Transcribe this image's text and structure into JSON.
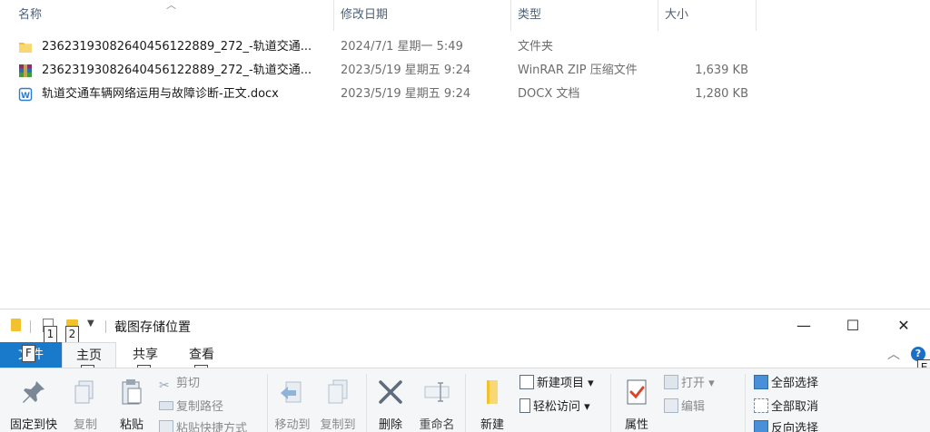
{
  "columns": {
    "name": "名称",
    "modified": "修改日期",
    "type": "类型",
    "size": "大小"
  },
  "files": [
    {
      "icon": "folder-icon",
      "name": "23623193082640456122889_272_-轨道交通...",
      "modified": "2024/7/1 星期一 5:49",
      "type": "文件夹",
      "size": ""
    },
    {
      "icon": "winrar-archive-icon",
      "name": "23623193082640456122889_272_-轨道交通...",
      "modified": "2023/5/19 星期五 9:24",
      "type": "WinRAR ZIP 压缩文件",
      "size": "1,639 KB"
    },
    {
      "icon": "word-document-icon",
      "name": "轨道交通车辆网络运用与故障诊断-正文.docx",
      "modified": "2023/5/19 星期五 9:24",
      "type": "DOCX 文档",
      "size": "1,280 KB"
    }
  ],
  "window": {
    "title": "截图存储位置",
    "minimize": "—",
    "maximize": "☐",
    "close": "✕"
  },
  "keytips": {
    "qat1": "1",
    "qat2": "2",
    "file": "F",
    "home": "H",
    "share": "S",
    "view": "V",
    "help": "E"
  },
  "tabs": {
    "file": "文件",
    "home": "主页",
    "share": "共享",
    "view": "查看"
  },
  "ribbon": {
    "pin": "固定到快",
    "copy": "复制",
    "paste": "粘贴",
    "cut": "剪切",
    "copy_path": "复制路径",
    "paste_shortcut": "粘贴快捷方式",
    "move_to": "移动到",
    "copy_to": "复制到",
    "delete": "删除",
    "rename": "重命名",
    "new": "新建",
    "new_item": "新建项目",
    "easy_access": "轻松访问",
    "properties": "属性",
    "open": "打开",
    "edit": "编辑",
    "select_all": "全部选择",
    "select_none": "全部取消",
    "invert_selection": "反向选择"
  },
  "colors": {
    "accent": "#1979ca",
    "folder": "#f2c12e"
  }
}
